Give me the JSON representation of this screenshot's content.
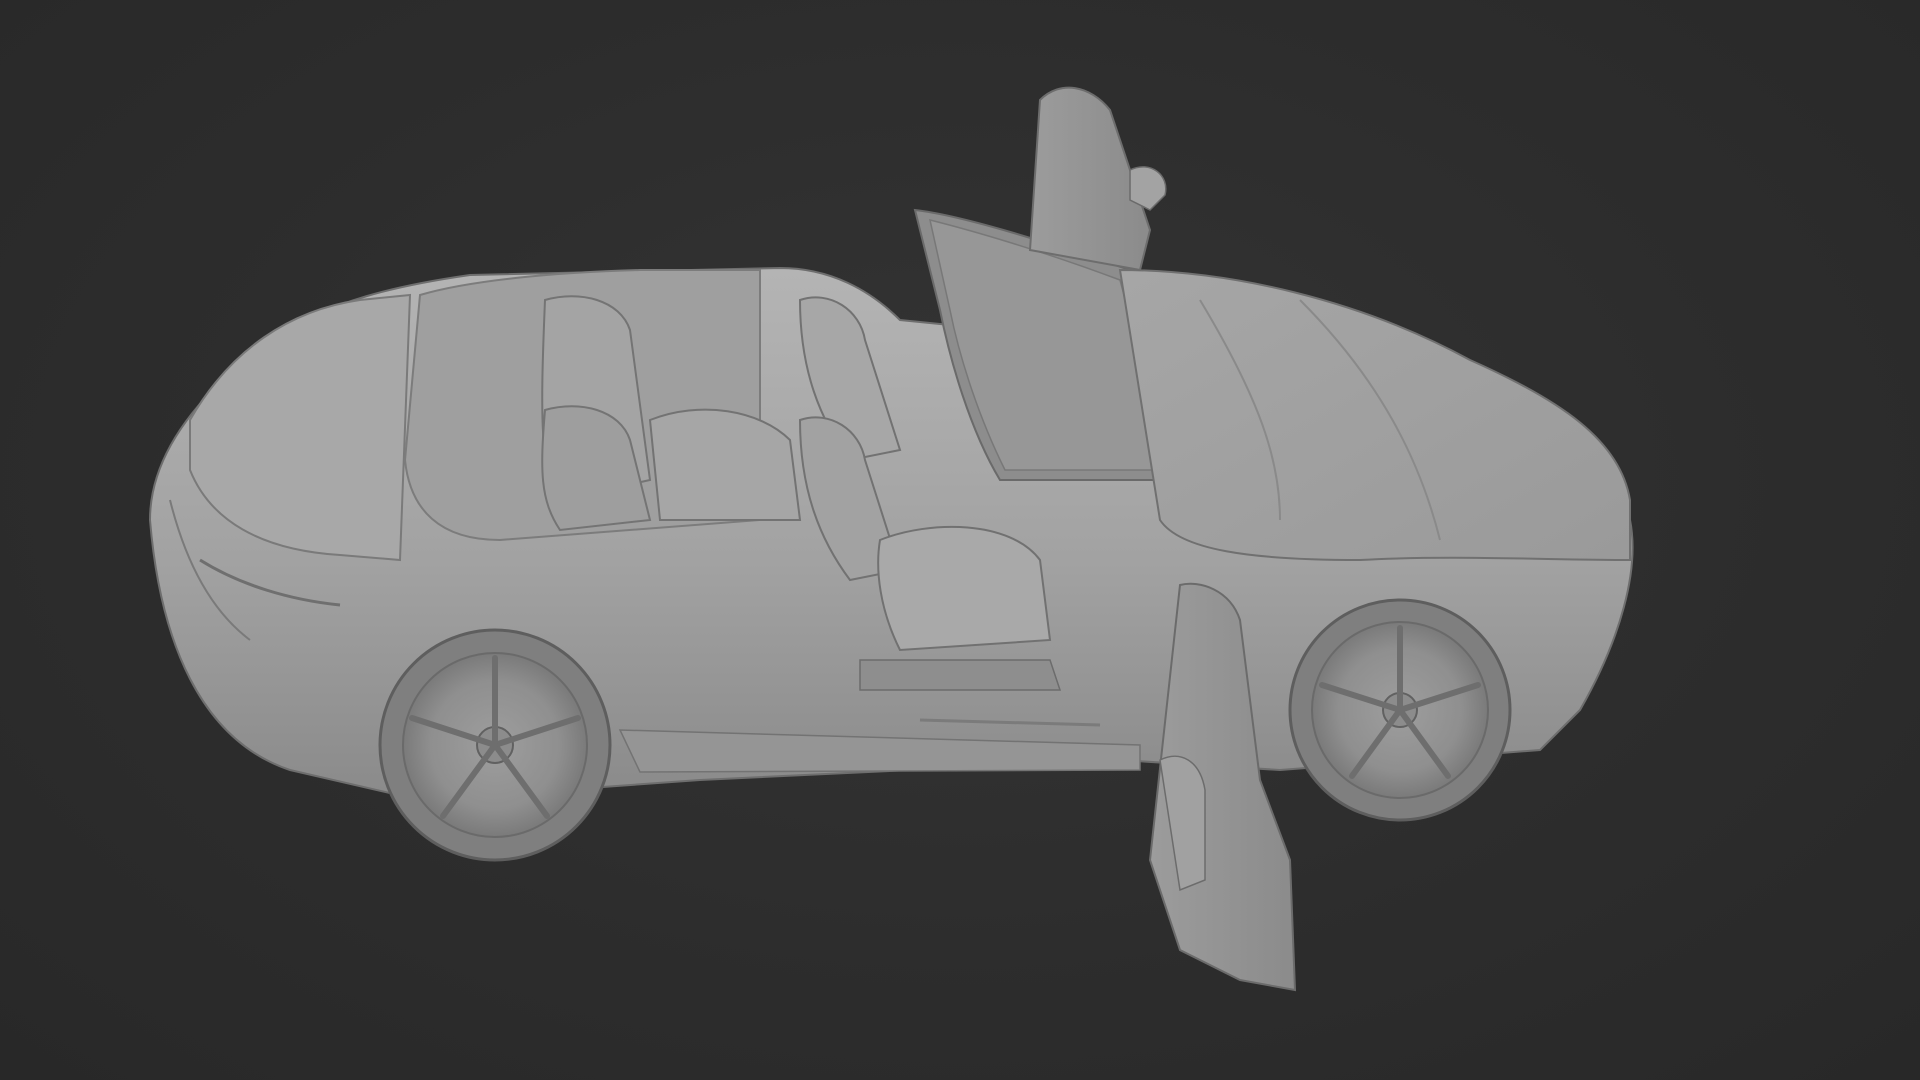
{
  "viewport": {
    "background_color": "#2b2b2b",
    "render_mode": "solid-shading",
    "object": {
      "kind": "convertible car 3D model",
      "color": "#a9a9a9",
      "state": "top down, hood open, doors open"
    }
  }
}
